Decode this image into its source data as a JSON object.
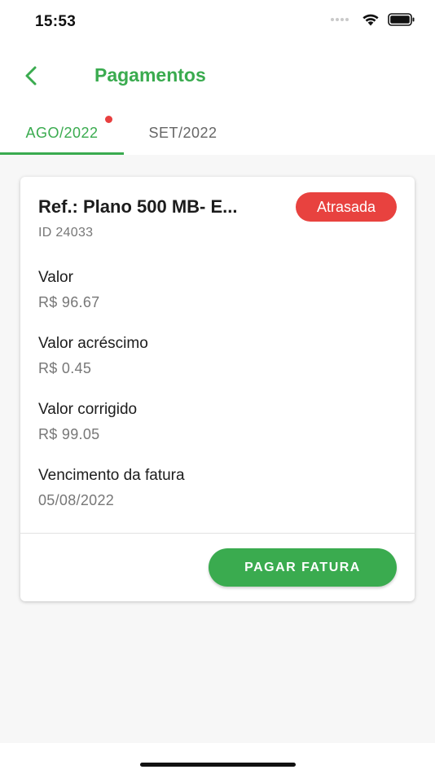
{
  "status_bar": {
    "time": "15:53"
  },
  "header": {
    "title": "Pagamentos"
  },
  "tabs": [
    {
      "label": "AGO/2022",
      "active": true,
      "has_notification": true
    },
    {
      "label": "SET/2022",
      "active": false,
      "has_notification": false
    }
  ],
  "invoice": {
    "title": "Ref.: Plano 500 MB- E...",
    "id": "ID 24033",
    "status": "Atrasada",
    "fields": [
      {
        "label": "Valor",
        "value": "R$ 96.67"
      },
      {
        "label": "Valor acréscimo",
        "value": "R$ 0.45"
      },
      {
        "label": "Valor corrigido",
        "value": "R$ 99.05"
      },
      {
        "label": "Vencimento da fatura",
        "value": "05/08/2022"
      }
    ],
    "action_label": "PAGAR FATURA"
  },
  "colors": {
    "brand_green": "#3aab4f",
    "status_red": "#e8423f",
    "notification_dot": "#e83f3f"
  },
  "icons": {
    "back": "chevron-left-icon",
    "wifi": "wifi-icon",
    "battery": "battery-icon",
    "signal": "cellular-signal-icon"
  }
}
